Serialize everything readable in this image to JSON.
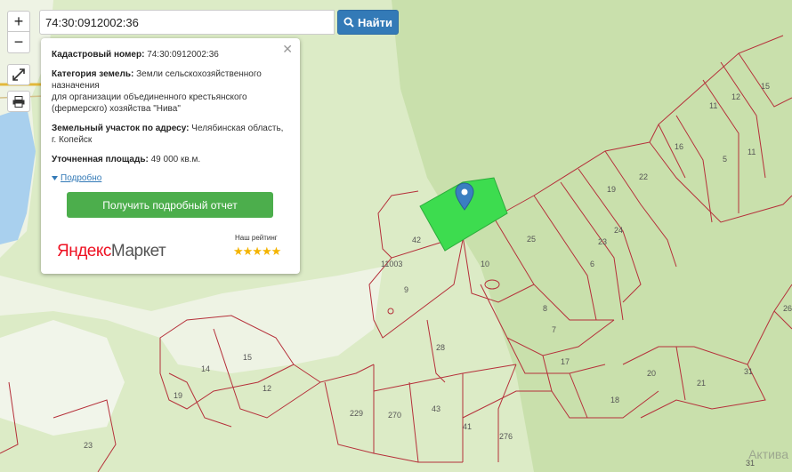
{
  "search": {
    "value": "74:30:0912002:36",
    "button_label": "Найти"
  },
  "controls": {
    "zoom_in": "+",
    "zoom_out": "−",
    "fullscreen_icon": "expand-icon",
    "print_icon": "print-icon"
  },
  "popup": {
    "cadastral_label": "Кадастровый номер:",
    "cadastral_value": "74:30:0912002:36",
    "category_label": "Категория земель:",
    "category_value_1": "Земли сельскохозяйственного",
    "category_value_2": "назначения",
    "purpose_1": "для организации объединенного крестьянского",
    "purpose_2": "(фермерскго) хозяйства \"Нива\"",
    "address_label": "Земельный участок по адресу:",
    "address_value_1": "Челябинская область,",
    "address_value_2": "г. Копейск",
    "area_label": "Уточненная площадь:",
    "area_value": "49 000 кв.м.",
    "details_link": "Подробно",
    "report_button": "Получить подробный отчет",
    "ad": {
      "logo_part1": "Яндекс",
      "logo_part2": "Маркет",
      "rating_label": "Наш рейтинг",
      "stars": "★★★★★"
    }
  },
  "map": {
    "parcel_labels": [
      "15",
      "12",
      "11",
      "16",
      "5",
      "11",
      "22",
      "19",
      "24",
      "25",
      "23",
      "6",
      "42",
      "11003",
      "10",
      "9",
      "8",
      "7",
      "17",
      "18",
      "20",
      "21",
      "31",
      "26",
      "15",
      "14",
      "12",
      "19",
      "28",
      "229",
      "270",
      "43",
      "41",
      "276",
      "23",
      "31"
    ],
    "selected_parcel_color": "#3ddc4f",
    "boundary_color": "#b5303a"
  },
  "watermark": "Актива"
}
